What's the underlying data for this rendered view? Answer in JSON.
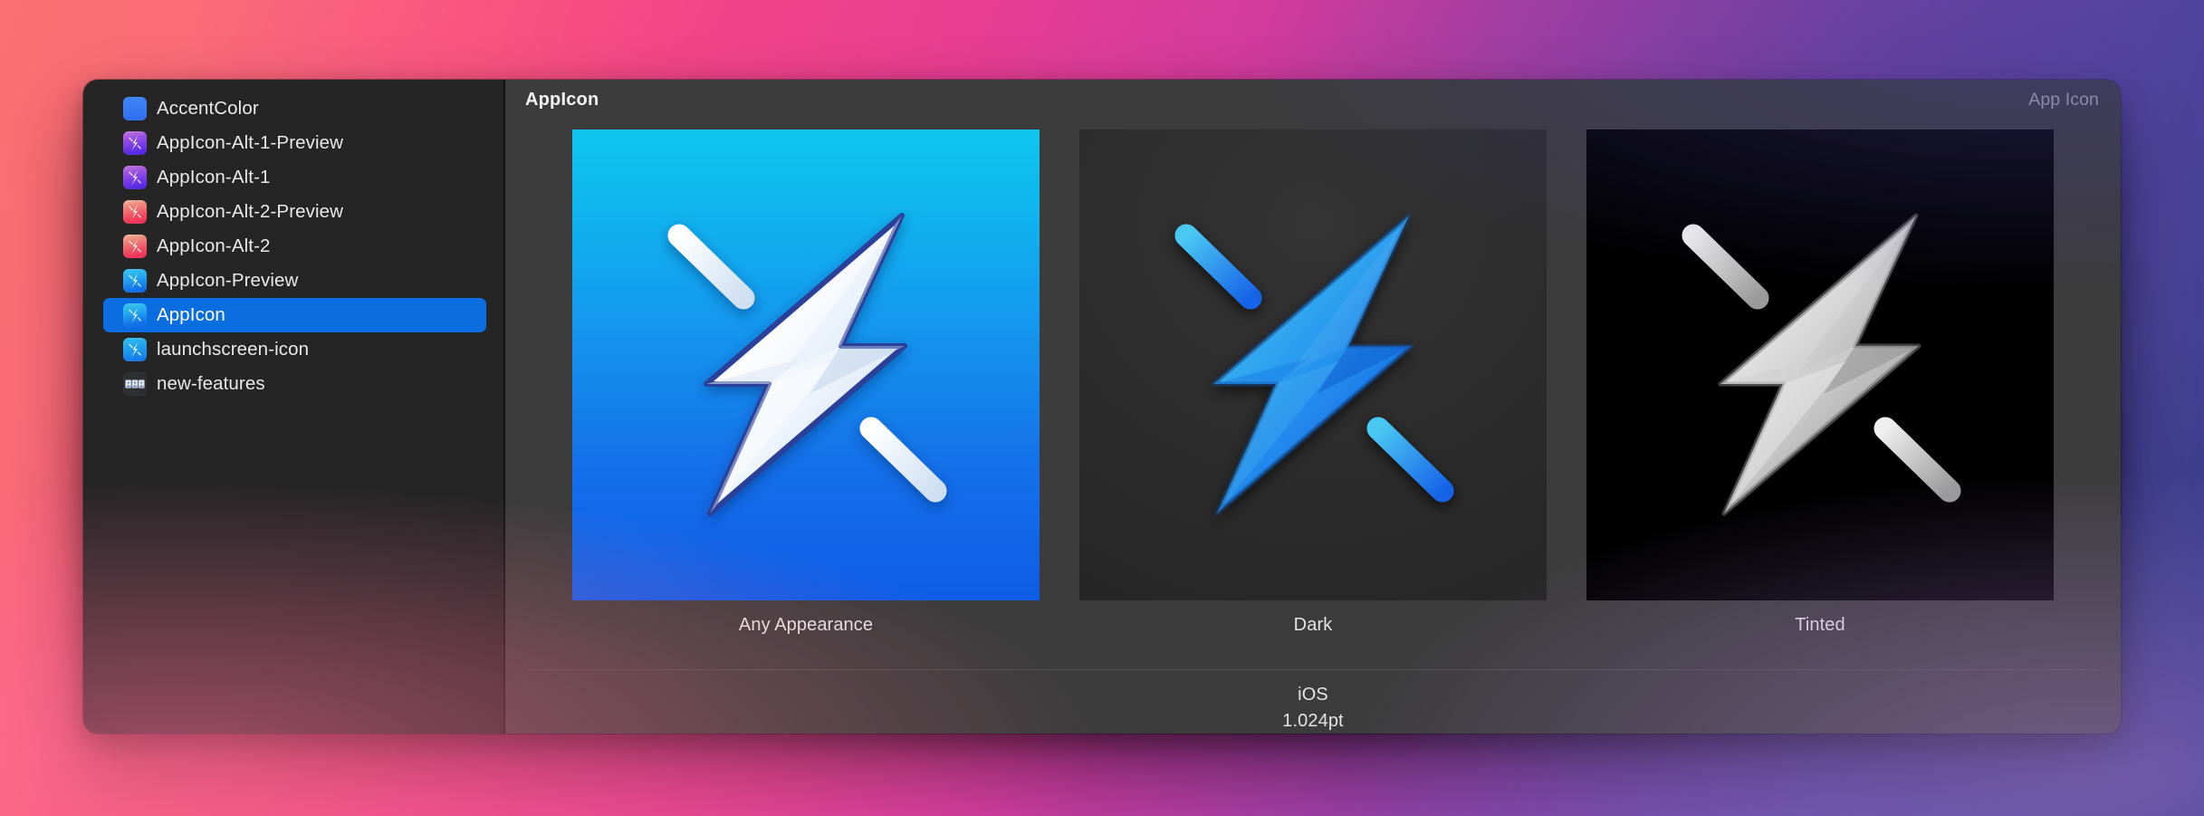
{
  "window": {
    "title": "AppIcon"
  },
  "sidebar": {
    "items": [
      {
        "label": "AccentColor",
        "icon": "color-swatch-icon",
        "thumb": "accent"
      },
      {
        "label": "AppIcon-Alt-1-Preview",
        "icon": "app-icon-thumbnail",
        "thumb": "purple"
      },
      {
        "label": "AppIcon-Alt-1",
        "icon": "app-icon-thumbnail",
        "thumb": "purple"
      },
      {
        "label": "AppIcon-Alt-2-Preview",
        "icon": "app-icon-thumbnail",
        "thumb": "salmon"
      },
      {
        "label": "AppIcon-Alt-2",
        "icon": "app-icon-thumbnail",
        "thumb": "salmon"
      },
      {
        "label": "AppIcon-Preview",
        "icon": "app-icon-thumbnail",
        "thumb": "cyan"
      },
      {
        "label": "AppIcon",
        "icon": "app-icon-thumbnail",
        "thumb": "cyan",
        "selected": true
      },
      {
        "label": "launchscreen-icon",
        "icon": "app-icon-thumbnail",
        "thumb": "cyan2"
      },
      {
        "label": "new-features",
        "icon": "image-set-icon",
        "thumb": "imgset"
      }
    ]
  },
  "toolbar": {
    "title": "AppIcon",
    "kind_label": "App Icon"
  },
  "canvas": {
    "appearances": [
      {
        "caption": "Any Appearance",
        "variant": "any",
        "bolt": "lightning-bolt-icon"
      },
      {
        "caption": "Dark",
        "variant": "dark",
        "bolt": "lightning-bolt-icon"
      },
      {
        "caption": "Tinted",
        "variant": "tinted",
        "bolt": "lightning-bolt-icon"
      }
    ]
  },
  "footer": {
    "platform": "iOS",
    "size": "1.024pt"
  },
  "colors": {
    "selection_blue": "#0b6ee0",
    "sidebar_bg": "#252526",
    "panel_bg": "#3c3c3c",
    "tinted_bg": "#000000"
  }
}
